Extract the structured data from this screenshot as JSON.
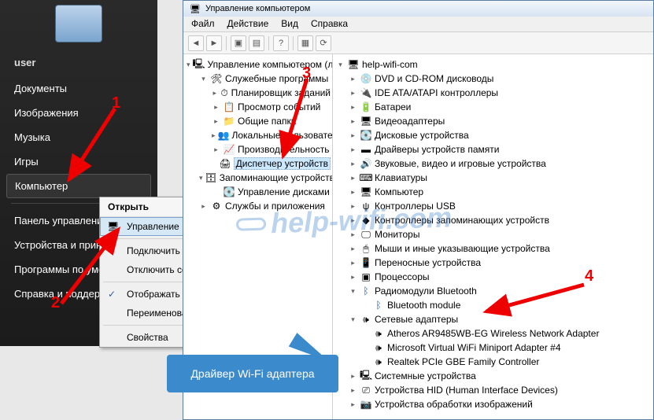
{
  "start_menu": {
    "user": "user",
    "items": [
      "Документы",
      "Изображения",
      "Музыка",
      "Игры",
      "Компьютер",
      "Панель управления",
      "Устройства и принтеры",
      "Программы по умолчанию",
      "Справка и поддержка"
    ],
    "selected_index": 4
  },
  "context_menu": {
    "header": "Открыть",
    "items": [
      {
        "label": "Управление",
        "selected": true,
        "icon": true
      },
      {
        "label": "Подключить сетевой диск..."
      },
      {
        "label": "Отключить сетевой диск..."
      },
      {
        "label": "Отображать на рабочем столе",
        "checked": true
      },
      {
        "label": "Переименовать"
      },
      {
        "label": "Свойства"
      }
    ]
  },
  "mmc": {
    "title": "Управление компьютером",
    "menu": [
      "Файл",
      "Действие",
      "Вид",
      "Справка"
    ],
    "left_tree": {
      "root": "Управление компьютером (локальный)",
      "groups": [
        {
          "label": "Служебные программы",
          "children": [
            "Планировщик заданий",
            "Просмотр событий",
            "Общие папки",
            "Локальные пользователи",
            "Производительность",
            "Диспетчер устройств"
          ],
          "selected": "Диспетчер устройств"
        },
        {
          "label": "Запоминающие устройства",
          "children": [
            "Управление дисками"
          ]
        },
        {
          "label": "Службы и приложения"
        }
      ]
    },
    "right_tree": {
      "root": "help-wifi-com",
      "nodes": [
        {
          "label": "DVD и CD-ROM дисководы"
        },
        {
          "label": "IDE ATA/ATAPI контроллеры"
        },
        {
          "label": "Батареи"
        },
        {
          "label": "Видеоадаптеры"
        },
        {
          "label": "Дисковые устройства"
        },
        {
          "label": "Драйверы устройств памяти"
        },
        {
          "label": "Звуковые, видео и игровые устройства"
        },
        {
          "label": "Клавиатуры"
        },
        {
          "label": "Компьютер"
        },
        {
          "label": "Контроллеры USB"
        },
        {
          "label": "Контроллеры запоминающих устройств"
        },
        {
          "label": "Мониторы"
        },
        {
          "label": "Мыши и иные указывающие устройства"
        },
        {
          "label": "Переносные устройства"
        },
        {
          "label": "Процессоры"
        },
        {
          "label": "Радиомодули Bluetooth",
          "expanded": true,
          "children": [
            "Bluetooth module"
          ]
        },
        {
          "label": "Сетевые адаптеры",
          "expanded": true,
          "children": [
            "Atheros AR9485WB-EG Wireless Network Adapter",
            "Microsoft Virtual WiFi Miniport Adapter #4",
            "Realtek PCIe GBE Family Controller"
          ]
        },
        {
          "label": "Системные устройства"
        },
        {
          "label": "Устройства HID (Human Interface Devices)"
        },
        {
          "label": "Устройства обработки изображений"
        }
      ]
    }
  },
  "annotations": {
    "n1": "1",
    "n2": "2",
    "n3": "3",
    "n4": "4",
    "callout": "Драйвер Wi-Fi адаптера",
    "watermark": "help-wifi.com"
  }
}
